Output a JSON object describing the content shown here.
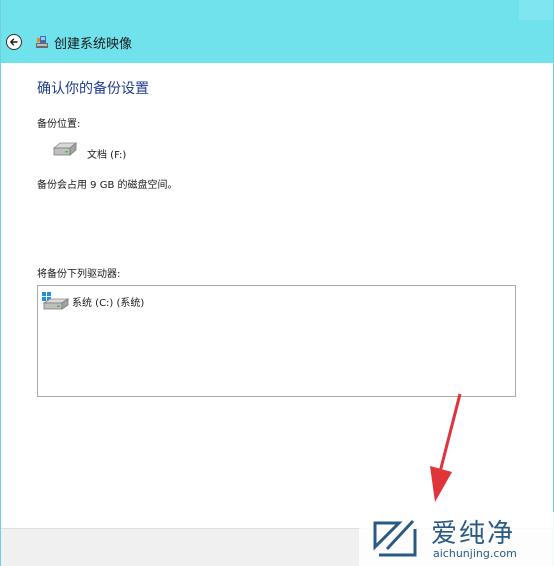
{
  "window": {
    "title": "创建系统映像"
  },
  "main": {
    "heading": "确认你的备份设置",
    "backup_location_label": "备份位置:",
    "backup_target_drive": "文档 (F:)",
    "space_note": "备份会占用 9 GB 的磁盘空间。",
    "drives_label": "将备份下列驱动器:",
    "drives": [
      {
        "label": "系统 (C:) (系统)"
      }
    ]
  },
  "watermark": {
    "name": "爱纯净",
    "url": "aichunjing.com"
  },
  "colors": {
    "titlebar": "#70e2ec",
    "heading": "#1e3d8f",
    "arrow": "#e0333a",
    "watermark": "#2a5a83"
  },
  "icons": {
    "back": "back-arrow-icon",
    "app": "system-image-icon",
    "drive": "hard-drive-icon",
    "system_drive": "windows-drive-icon"
  }
}
